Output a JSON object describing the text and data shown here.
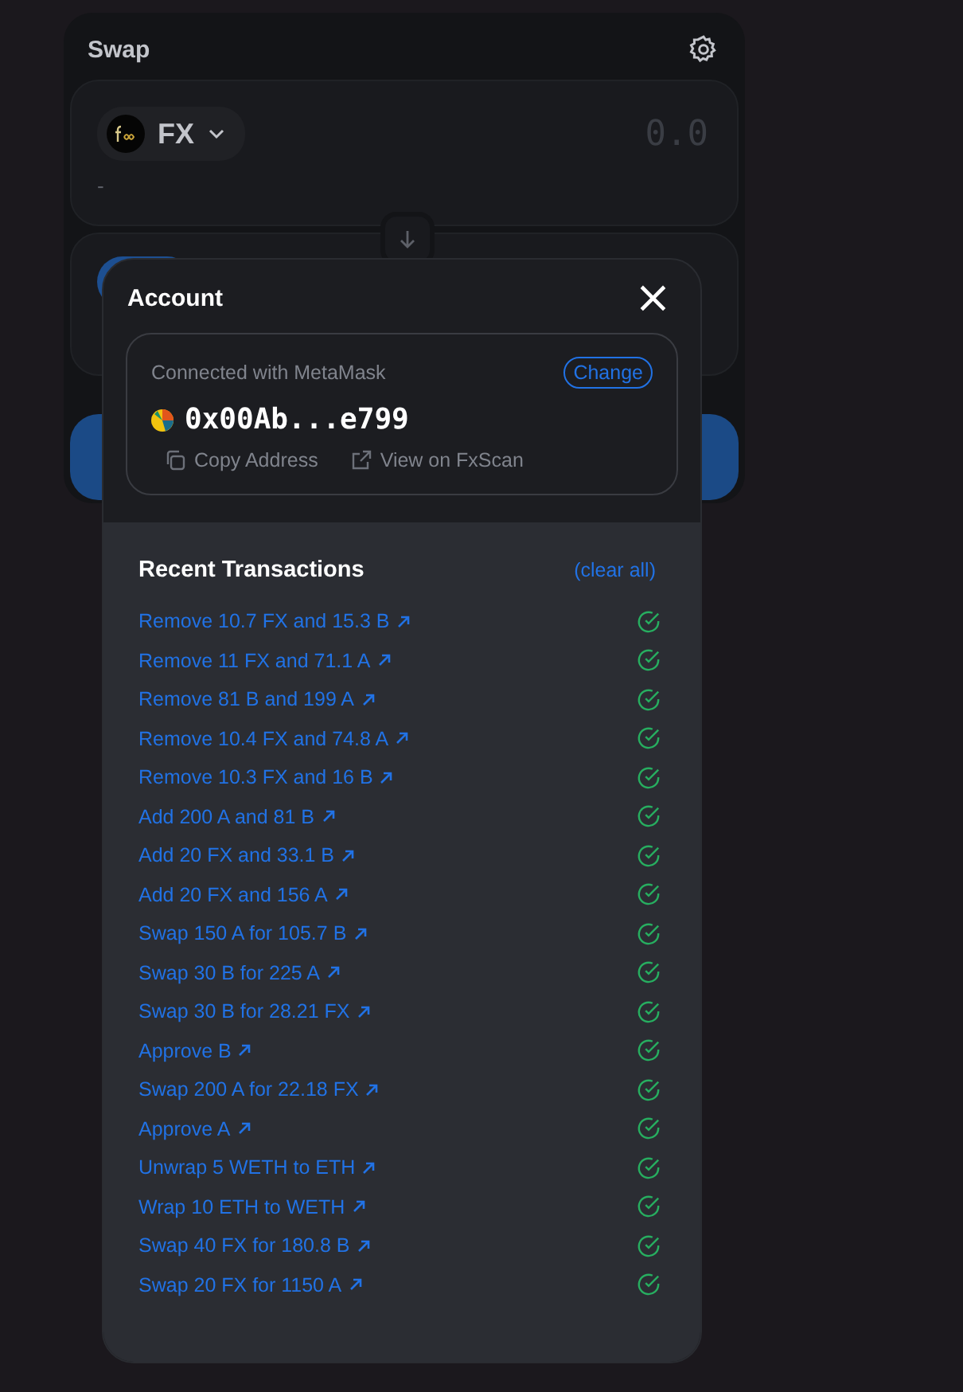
{
  "swap": {
    "title": "Swap",
    "input": {
      "token": "FX",
      "amount_placeholder": "0.0",
      "balance": "-"
    }
  },
  "account": {
    "title": "Account",
    "close": "×",
    "wallet_label": "Connected with MetaMask",
    "change_button": "Change",
    "address": "0x00Ab...e799",
    "actions": [
      "Copy Address",
      "View on FxScan"
    ]
  },
  "transactions": {
    "title": "Recent Transactions",
    "clear": "(clear all)",
    "items": [
      {
        "label": "Remove 10.7 FX and 15.3 B",
        "confirmed": true
      },
      {
        "label": "Remove 11 FX and 71.1 A",
        "confirmed": true
      },
      {
        "label": "Remove 81 B and 199 A",
        "confirmed": true
      },
      {
        "label": "Remove 10.4 FX and 74.8 A",
        "confirmed": true
      },
      {
        "label": "Remove 10.3 FX and 16 B",
        "confirmed": true
      },
      {
        "label": "Add 200 A and 81 B",
        "confirmed": true
      },
      {
        "label": "Add 20 FX and 33.1 B",
        "confirmed": true
      },
      {
        "label": "Add 20 FX and 156 A",
        "confirmed": true
      },
      {
        "label": "Swap 150 A for 105.7 B",
        "confirmed": true
      },
      {
        "label": "Swap 30 B for 225 A",
        "confirmed": true
      },
      {
        "label": "Swap 30 B for 28.21 FX",
        "confirmed": true
      },
      {
        "label": "Approve B",
        "confirmed": true
      },
      {
        "label": "Swap 200 A for 22.18 FX",
        "confirmed": true
      },
      {
        "label": "Approve A",
        "confirmed": true
      },
      {
        "label": "Unwrap 5 WETH to ETH",
        "confirmed": true
      },
      {
        "label": "Wrap 10 ETH to WETH",
        "confirmed": true
      },
      {
        "label": "Swap 40 FX for 180.8 B",
        "confirmed": true
      },
      {
        "label": "Swap 20 FX for 1150 A",
        "confirmed": true
      }
    ]
  }
}
